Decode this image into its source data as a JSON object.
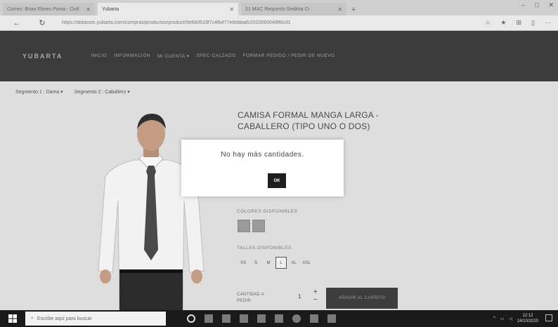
{
  "browser": {
    "tabs": [
      {
        "label": "Correo: Brian Flores Poma - Outl",
        "active": false
      },
      {
        "label": "Yubarta",
        "active": true
      },
      {
        "label": "21 MAC Requests Sedinta  Ci",
        "active": false
      }
    ],
    "url": "https://dotacion.yubarta.com/compras/productos/product/5e6b0519f7c4fb477e6ebba6/2020060048ff8cd1",
    "window_controls": {
      "minimize": "–",
      "maximize": "□",
      "close": "✕"
    }
  },
  "site": {
    "logo": "YUBARTA",
    "menu": [
      "INICIO",
      "INFORMACIÓN",
      "MI CUENTA ▾",
      "SPEC CALZADO",
      "FORMAR PEDIDO / PEDIR DE NUEVO"
    ],
    "segments": [
      "Segmento 1 : Dama ▾",
      "Segmento 2 : Caballero ▾"
    ]
  },
  "product": {
    "title": "CAMISA FORMAL MANGA LARGA - CABALLERO (TIPO UNO O DOS)",
    "colors_label": "COLORES DISPONIBLES",
    "sizes_label": "TALLAS DISPONIBLES",
    "sizes": [
      "XS",
      "S",
      "M",
      "L",
      "XL",
      "XXL"
    ],
    "selected_size": "L",
    "qty_label": "CANTIDAD A PEDIR",
    "qty_value": "1",
    "add_to_cart": "AÑADIR AL CARRITO"
  },
  "modal": {
    "message": "No hay más cantidades.",
    "ok_label": "OK"
  },
  "taskbar": {
    "search_placeholder": "Escribe aquí para buscar",
    "time": "12:12",
    "date": "24/10/2020"
  },
  "colors": {
    "header_bg": "#3b3b3b",
    "modal_ok_bg": "#1f1f1f",
    "taskbar_bg": "#1a1a1a"
  }
}
